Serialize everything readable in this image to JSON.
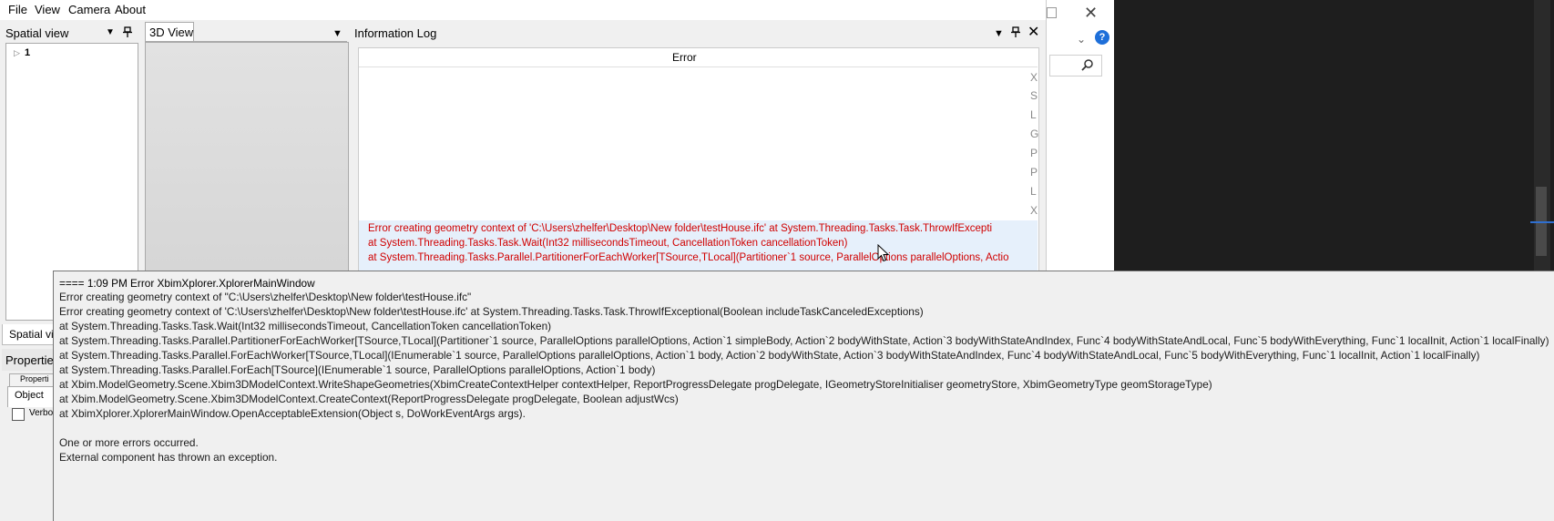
{
  "menu": [
    "File",
    "View",
    "Camera",
    "About"
  ],
  "spatial": {
    "title": "Spatial view",
    "dropdown_icon": "▼",
    "pin_icon": "📌",
    "tree_item": "1",
    "tab2": "Spatial vi"
  },
  "properties": {
    "title": "Properties",
    "tab": "Properti",
    "object_tab": "Object",
    "verbose": "Verbo"
  },
  "view3d": {
    "title": "3D View"
  },
  "info_log": {
    "title": "Information Log",
    "column_header": "Error",
    "side_chars": [
      "X",
      "S",
      "L",
      "G",
      "P",
      "P",
      "L",
      "X"
    ],
    "error_lines": [
      "Error creating geometry context of 'C:\\Users\\zhelfer\\Desktop\\New folder\\testHouse.ifc'     at System.Threading.Tasks.Task.ThrowIfExcepti",
      "   at System.Threading.Tasks.Task.Wait(Int32 millisecondsTimeout, CancellationToken cancellationToken)",
      "   at System.Threading.Tasks.Parallel.PartitionerForEachWorker[TSource,TLocal](Partitioner`1 source, ParallelOptions parallelOptions, Actio"
    ]
  },
  "tooltip": {
    "header": "==== 1:09 PM     Error      XbimXplorer.XplorerMainWindow",
    "lines": [
      "Error creating geometry context of \"C:\\Users\\zhelfer\\Desktop\\New folder\\testHouse.ifc\"",
      "Error creating geometry context of 'C:\\Users\\zhelfer\\Desktop\\New folder\\testHouse.ifc'     at System.Threading.Tasks.Task.ThrowIfExceptional(Boolean includeTaskCanceledExceptions)",
      "   at System.Threading.Tasks.Task.Wait(Int32 millisecondsTimeout, CancellationToken cancellationToken)",
      "   at System.Threading.Tasks.Parallel.PartitionerForEachWorker[TSource,TLocal](Partitioner`1 source, ParallelOptions parallelOptions, Action`1 simpleBody, Action`2 bodyWithState, Action`3 bodyWithStateAndIndex, Func`4 bodyWithStateAndLocal, Func`5 bodyWithEverything, Func`1 localInit, Action`1 localFinally)",
      "   at System.Threading.Tasks.Parallel.ForEachWorker[TSource,TLocal](IEnumerable`1 source, ParallelOptions parallelOptions, Action`1 body, Action`2 bodyWithState, Action`3 bodyWithStateAndIndex, Func`4 bodyWithStateAndLocal, Func`5 bodyWithEverything, Func`1 localInit, Action`1 localFinally)",
      "   at System.Threading.Tasks.Parallel.ForEach[TSource](IEnumerable`1 source, ParallelOptions parallelOptions, Action`1 body)",
      "   at Xbim.ModelGeometry.Scene.Xbim3DModelContext.WriteShapeGeometries(XbimCreateContextHelper contextHelper, ReportProgressDelegate progDelegate, IGeometryStoreInitialiser geometryStore, XbimGeometryType geomStorageType)",
      "   at Xbim.ModelGeometry.Scene.Xbim3DModelContext.CreateContext(ReportProgressDelegate progDelegate, Boolean adjustWcs)",
      "   at XbimXplorer.XplorerMainWindow.OpenAcceptableExtension(Object s, DoWorkEventArgs args).",
      "",
      "One or more errors occurred.",
      "External component has thrown an exception."
    ]
  },
  "colors": {
    "error_red": "#d00000",
    "selection_blue": "#e6f0fb",
    "dark_editor": "#1e1e1e",
    "help_blue": "#1e6fd9"
  }
}
